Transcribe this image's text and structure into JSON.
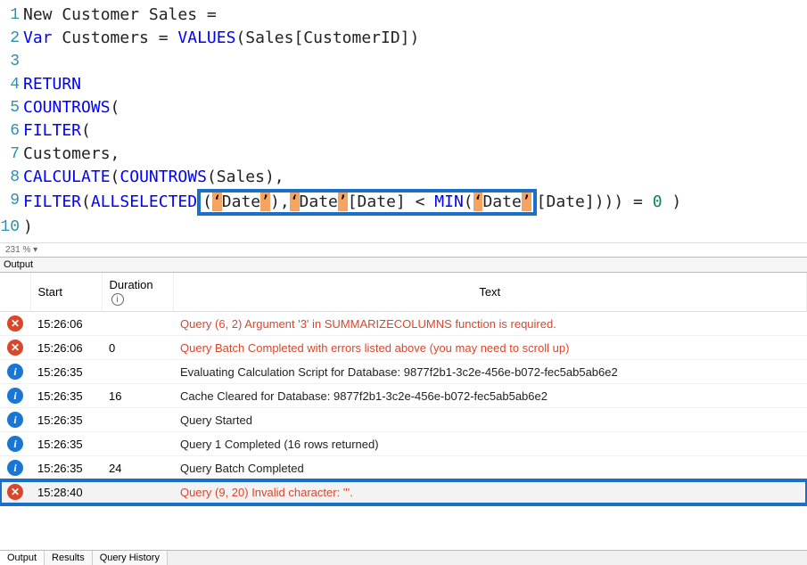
{
  "code": {
    "lines": [
      {
        "num": "1",
        "tokens": [
          [
            "txt",
            "New Customer Sales "
          ],
          [
            "txt",
            "="
          ]
        ]
      },
      {
        "num": "2",
        "tokens": [
          [
            "kw",
            "Var"
          ],
          [
            "txt",
            " Customers "
          ],
          [
            "txt",
            "= "
          ],
          [
            "fn",
            "VALUES"
          ],
          [
            "txt",
            "(Sales[CustomerID])"
          ]
        ]
      },
      {
        "num": "3",
        "tokens": []
      },
      {
        "num": "4",
        "tokens": [
          [
            "kw",
            "RETURN"
          ]
        ]
      },
      {
        "num": "5",
        "tokens": [
          [
            "fn",
            "COUNTROWS"
          ],
          [
            "txt",
            "("
          ]
        ]
      },
      {
        "num": "6",
        "tokens": [
          [
            "fn",
            "FILTER"
          ],
          [
            "txt",
            "("
          ]
        ]
      },
      {
        "num": "7",
        "tokens": [
          [
            "txt",
            "Customers,"
          ]
        ]
      },
      {
        "num": "8",
        "tokens": [
          [
            "fn",
            "CALCULATE"
          ],
          [
            "txt",
            "("
          ],
          [
            "fn",
            "COUNTROWS"
          ],
          [
            "txt",
            "(Sales),"
          ]
        ]
      },
      {
        "num": "9",
        "tokens": [
          [
            "fn",
            "FILTER"
          ],
          [
            "txt",
            "("
          ],
          [
            "fn",
            "ALLSELECTED"
          ],
          [
            "box-start",
            ""
          ],
          [
            "txt",
            "("
          ],
          [
            "hl",
            "‘"
          ],
          [
            "txt",
            "Date"
          ],
          [
            "hl",
            "’"
          ],
          [
            "txt",
            "),"
          ],
          [
            "hl",
            "‘"
          ],
          [
            "txt",
            "Date"
          ],
          [
            "hl",
            "’"
          ],
          [
            "txt",
            "[Date] < "
          ],
          [
            "fn",
            "MIN"
          ],
          [
            "txt",
            "("
          ],
          [
            "hl",
            "‘"
          ],
          [
            "txt",
            "Date"
          ],
          [
            "hl",
            "’"
          ],
          [
            "box-end",
            ""
          ],
          [
            "txt",
            "[Date]))) = "
          ],
          [
            "num",
            "0"
          ],
          [
            "txt",
            " )"
          ]
        ]
      },
      {
        "num": "10",
        "tokens": [
          [
            "txt",
            ")"
          ]
        ]
      }
    ]
  },
  "zoom": "231 %",
  "output_label": "Output",
  "columns": {
    "start": "Start",
    "duration": "Duration",
    "text": "Text"
  },
  "rows": [
    {
      "type": "error",
      "start": "15:26:06",
      "duration": "",
      "text": "Query (6, 2) Argument '3' in SUMMARIZECOLUMNS function is required."
    },
    {
      "type": "error",
      "start": "15:26:06",
      "duration": "0",
      "text": "Query Batch Completed with errors listed above (you may need to scroll up)"
    },
    {
      "type": "info",
      "start": "15:26:35",
      "duration": "",
      "text": "Evaluating Calculation Script for Database: 9877f2b1-3c2e-456e-b072-fec5ab5ab6e2"
    },
    {
      "type": "info",
      "start": "15:26:35",
      "duration": "16",
      "text": "Cache Cleared for Database: 9877f2b1-3c2e-456e-b072-fec5ab5ab6e2"
    },
    {
      "type": "info",
      "start": "15:26:35",
      "duration": "",
      "text": "Query Started"
    },
    {
      "type": "info",
      "start": "15:26:35",
      "duration": "",
      "text": "Query 1 Completed (16 rows returned)"
    },
    {
      "type": "info",
      "start": "15:26:35",
      "duration": "24",
      "text": "Query Batch Completed"
    },
    {
      "type": "error",
      "start": "15:28:40",
      "duration": "",
      "text": "Query (9, 20) Invalid character: '''.",
      "highlight": true
    }
  ],
  "tabs": {
    "output": "Output",
    "results": "Results",
    "history": "Query History"
  }
}
